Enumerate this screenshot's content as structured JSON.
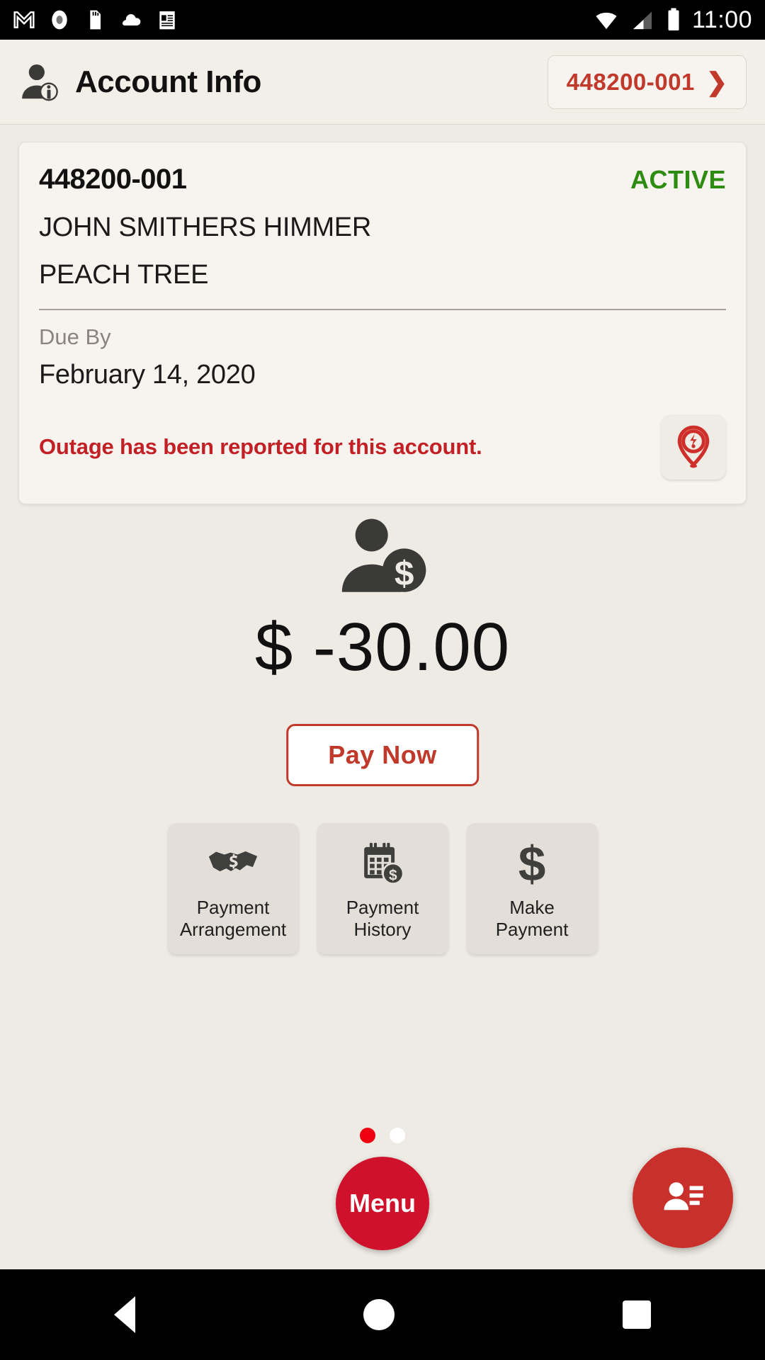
{
  "status_bar": {
    "time": "11:00",
    "left_icons": [
      "gmail-icon",
      "record-icon",
      "sd-card-icon",
      "cloud-icon",
      "news-icon"
    ],
    "right_icons": [
      "wifi-icon",
      "cellular-signal-icon",
      "battery-icon"
    ]
  },
  "header": {
    "icon": "account-info-icon",
    "title": "Account Info",
    "account_chip": {
      "label": "448200-001",
      "chevron": "chevron-right-icon"
    }
  },
  "account_card": {
    "account_number": "448200-001",
    "status": "ACTIVE",
    "status_color": "#2e8b12",
    "customer_name": "JOHN SMITHERS HIMMER",
    "address": "PEACH TREE",
    "due_by_label": "Due By",
    "due_by_date": "February 14, 2020",
    "outage_message": "Outage has been reported for this account.",
    "outage_color": "#c32026",
    "outage_icon": "outage-pin-icon"
  },
  "balance": {
    "icon": "person-dollar-icon",
    "amount": "$ -30.00",
    "pay_now_label": "Pay Now",
    "accent_color": "#c0392b"
  },
  "tiles": [
    {
      "icon": "handshake-dollar-icon",
      "line1": "Payment",
      "line2": "Arrangement"
    },
    {
      "icon": "calendar-dollar-icon",
      "line1": "Payment",
      "line2": "History"
    },
    {
      "icon": "dollar-sign-icon",
      "line1": "Make",
      "line2": "Payment"
    }
  ],
  "pager": {
    "total": 2,
    "active_index": 0,
    "active_color": "#ee0011",
    "inactive_color": "#ffffff"
  },
  "bottom": {
    "menu_label": "Menu",
    "menu_color": "#d0112b",
    "contact_fab_icon": "contact-card-icon",
    "contact_fab_color": "#c9302c"
  },
  "nav_bar": {
    "back": "back-triangle-icon",
    "home": "home-circle-icon",
    "recents": "recents-square-icon"
  }
}
